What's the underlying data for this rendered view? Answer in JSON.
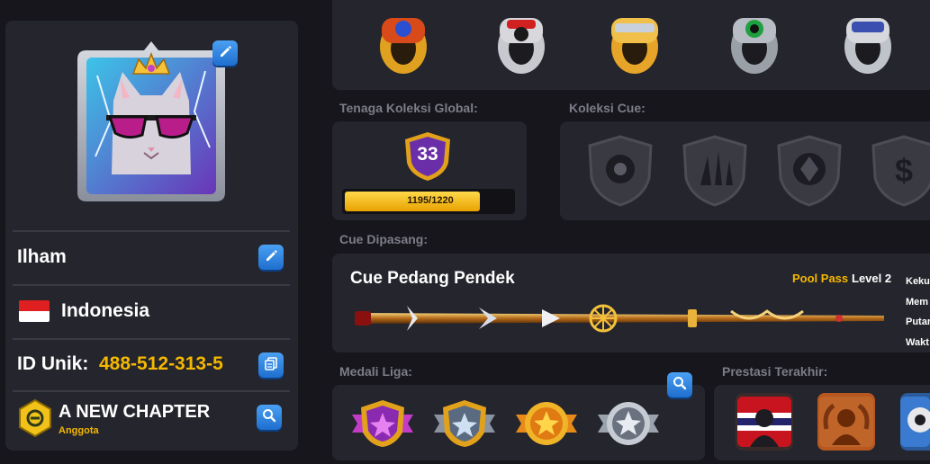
{
  "profile": {
    "name": "Ilham",
    "country": "Indonesia",
    "id_label": "ID Unik:",
    "id_value": "488-512-313-5",
    "club_name": "A NEW CHAPTER",
    "club_role": "Anggota"
  },
  "sections": {
    "global_collection": "Tenaga Koleksi Global:",
    "cue_collection": "Koleksi Cue:",
    "equipped_cue": "Cue Dipasang:",
    "league_medals": "Medali Liga:",
    "recent_achievements": "Prestasi Terakhir:"
  },
  "collection": {
    "level": "33",
    "progress_text": "1195/1220",
    "progress_fraction": 0.9795
  },
  "cue": {
    "name": "Cue Pedang Pendek",
    "pass_label": "Pool Pass",
    "level_label": "Level 2",
    "stats": [
      "Keku",
      "Mem",
      "Putar",
      "Wakt"
    ]
  },
  "icons": {
    "edit": "pencil-icon",
    "copy": "copy-icon",
    "search": "search-icon",
    "flag": "indonesia-flag-icon",
    "club": "club-badge-icon"
  },
  "colors": {
    "accent_yellow": "#f5b800",
    "button_blue": "#2f86e0",
    "panel": "#25252d",
    "background": "#16161c"
  }
}
